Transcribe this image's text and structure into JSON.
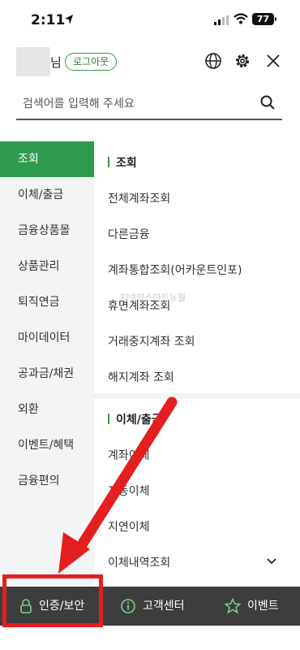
{
  "status_bar": {
    "time": "2:11",
    "battery": "77"
  },
  "header": {
    "user_suffix": "님",
    "logout_label": "로그아웃"
  },
  "search": {
    "placeholder": "검색어를 입력해 주세요"
  },
  "sidebar": {
    "items": [
      {
        "label": "조회",
        "active": true
      },
      {
        "label": "이체/출금"
      },
      {
        "label": "금융상품몰"
      },
      {
        "label": "상품관리"
      },
      {
        "label": "퇴직연금"
      },
      {
        "label": "마이데이터"
      },
      {
        "label": "공과금/채권"
      },
      {
        "label": "외환"
      },
      {
        "label": "이벤트/혜택"
      },
      {
        "label": "금융편의"
      }
    ]
  },
  "content": {
    "section1": {
      "title": "조회",
      "items": [
        "전체계좌조회",
        "다른금융",
        "계좌통합조회(어카운트인포)",
        "휴면계좌조회",
        "거래중지계좌 조회",
        "해지계좌 조회"
      ]
    },
    "section2": {
      "title": "이체/출금",
      "items": [
        "계좌이체",
        "자동이체",
        "지연이체",
        "이체내역조회"
      ]
    }
  },
  "watermark": "지넷의스마트뉴월",
  "bottom_bar": {
    "auth_label": "인증/보안",
    "cs_label": "고객센터",
    "event_label": "이벤트"
  },
  "colors": {
    "accent": "#2e9b4e",
    "bottom_bar": "#3d3d3d",
    "annotation": "#e41f1f"
  }
}
